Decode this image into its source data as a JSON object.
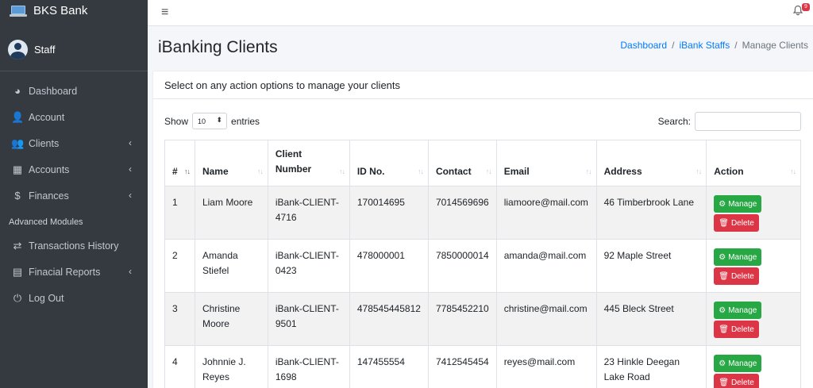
{
  "brand": {
    "name": "BKS Bank"
  },
  "user": {
    "name": "Staff"
  },
  "sidebar": {
    "items": [
      {
        "label": "Dashboard",
        "icon": "tachometer-icon",
        "glyph": "◕",
        "chevron": false
      },
      {
        "label": "Account",
        "icon": "user-tie-icon",
        "glyph": "👤",
        "chevron": false
      },
      {
        "label": "Clients",
        "icon": "users-icon",
        "glyph": "👥",
        "chevron": true
      },
      {
        "label": "Accounts",
        "icon": "briefcase-icon",
        "glyph": "▦",
        "chevron": true
      },
      {
        "label": "Finances",
        "icon": "dollar-icon",
        "glyph": "$",
        "chevron": true
      }
    ],
    "header": "Advanced Modules",
    "advanced": [
      {
        "label": "Transactions History",
        "icon": "exchange-icon",
        "glyph": "⇄",
        "chevron": false
      },
      {
        "label": "Finacial Reports",
        "icon": "file-invoice-icon",
        "glyph": "▤",
        "chevron": true
      },
      {
        "label": "Log Out",
        "icon": "power-off-icon",
        "glyph": "⏻",
        "chevron": false
      }
    ]
  },
  "topbar": {
    "notification_count": "9"
  },
  "page": {
    "title": "iBanking Clients",
    "breadcrumb": [
      "Dashboard",
      "iBank Staffs",
      "Manage Clients"
    ]
  },
  "card": {
    "header": "Select on any action options to manage your clients",
    "show_label": "Show",
    "entries_value": "10",
    "entries_label": "entries",
    "search_label": "Search:"
  },
  "table": {
    "columns": [
      "#",
      "Name",
      "Client Number",
      "ID No.",
      "Contact",
      "Email",
      "Address",
      "Action"
    ],
    "manage_label": "Manage",
    "delete_label": "Delete",
    "rows": [
      {
        "num": "1",
        "name": "Liam Moore",
        "client": "iBank-CLIENT-4716",
        "id": "170014695",
        "contact": "7014569696",
        "email": "liamoore@mail.com",
        "address": "46 Timberbrook Lane"
      },
      {
        "num": "2",
        "name": "Amanda Stiefel",
        "client": "iBank-CLIENT-0423",
        "id": "478000001",
        "contact": "7850000014",
        "email": "amanda@mail.com",
        "address": "92 Maple Street"
      },
      {
        "num": "3",
        "name": "Christine Moore",
        "client": "iBank-CLIENT-9501",
        "id": "478545445812",
        "contact": "7785452210",
        "email": "christine@mail.com",
        "address": "445 Bleck Street"
      },
      {
        "num": "4",
        "name": "Johnnie J. Reyes",
        "client": "iBank-CLIENT-1698",
        "id": "147455554",
        "contact": "7412545454",
        "email": "reyes@mail.com",
        "address": "23 Hinkle Deegan Lake Road"
      }
    ]
  },
  "colors": {
    "sidebar": "#343a40",
    "primary": "#007bff",
    "success": "#28a745",
    "danger": "#dc3545"
  }
}
